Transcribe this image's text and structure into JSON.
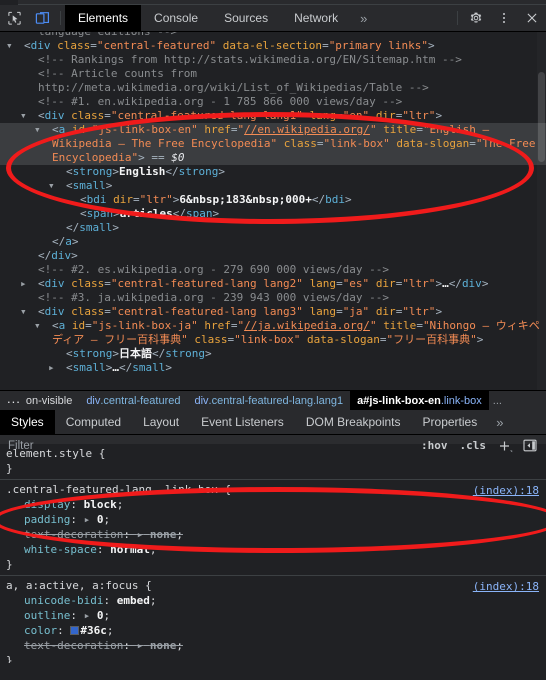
{
  "window": {
    "title": "Chrome DevTools — Elements panel"
  },
  "toolbar": {
    "icons": [
      {
        "name": "inspect-element-icon",
        "label": "Inspect element"
      },
      {
        "name": "device-toolbar-icon",
        "label": "Toggle device toolbar",
        "active": true
      }
    ],
    "tabs": [
      {
        "label": "Elements",
        "active": true
      },
      {
        "label": "Console",
        "active": false
      },
      {
        "label": "Sources",
        "active": false
      },
      {
        "label": "Network",
        "active": false
      }
    ],
    "more_tabs_label": "»",
    "right_icons": [
      {
        "name": "gear-icon",
        "label": "Settings"
      },
      {
        "name": "kebab-menu-icon",
        "label": "Customize and control DevTools"
      },
      {
        "name": "close-icon",
        "label": "Close DevTools"
      }
    ]
  },
  "dom": {
    "lines": [
      {
        "indent": 2,
        "type": "comment",
        "text": "language editions -->",
        "clipped_top": true
      },
      {
        "indent": 1,
        "type": "tag-open",
        "toggle": "open",
        "text": "<div class=\"central-featured\" data-el-section=\"primary links\">"
      },
      {
        "indent": 2,
        "type": "comment",
        "text": "<!-- Rankings from http://stats.wikimedia.org/EN/Sitemap.htm -->"
      },
      {
        "indent": 2,
        "type": "comment",
        "text": "<!-- Article counts from"
      },
      {
        "indent": 2,
        "type": "comment",
        "text": "http://meta.wikimedia.org/wiki/List_of_Wikipedias/Table -->"
      },
      {
        "indent": 2,
        "type": "comment",
        "text": "<!-- #1. en.wikipedia.org - 1 785 866 000 views/day -->"
      },
      {
        "indent": 2,
        "type": "tag-open",
        "toggle": "open",
        "text": "<div class=\"central-featured-lang lang1\" lang=\"en\" dir=\"ltr\">"
      },
      {
        "indent": 3,
        "type": "selected",
        "toggle": "open",
        "text": "<a id=\"js-link-box-en\" href=\"//en.wikipedia.org/\" title=\"English — Wikipedia — The Free Encyclopedia\" class=\"link-box\" data-slogan=\"The Free Encyclopedia\"> == $0"
      },
      {
        "indent": 4,
        "type": "element-text",
        "text": "<strong>English</strong>"
      },
      {
        "indent": 4,
        "type": "tag-open",
        "toggle": "open",
        "text": "<small>"
      },
      {
        "indent": 5,
        "type": "element-text",
        "text": "<bdi dir=\"ltr\">6&nbsp;183&nbsp;000+</bdi>"
      },
      {
        "indent": 5,
        "type": "element-text",
        "text": "<span>articles</span>"
      },
      {
        "indent": 4,
        "type": "tag-close",
        "text": "</small>"
      },
      {
        "indent": 3,
        "type": "tag-close",
        "text": "</a>"
      },
      {
        "indent": 2,
        "type": "tag-close",
        "text": "</div>"
      },
      {
        "indent": 2,
        "type": "comment",
        "text": "<!-- #2. es.wikipedia.org - 279 690 000 views/day -->"
      },
      {
        "indent": 2,
        "type": "tag-collapsed",
        "toggle": "closed",
        "text": "<div class=\"central-featured-lang lang2\" lang=\"es\" dir=\"ltr\">…</div>"
      },
      {
        "indent": 2,
        "type": "comment",
        "text": "<!-- #3. ja.wikipedia.org - 239 943 000 views/day -->"
      },
      {
        "indent": 2,
        "type": "tag-open",
        "toggle": "open",
        "text": "<div class=\"central-featured-lang lang3\" lang=\"ja\" dir=\"ltr\">"
      },
      {
        "indent": 3,
        "type": "tag-open",
        "toggle": "open",
        "text": "<a id=\"js-link-box-ja\" href=\"//ja.wikipedia.org/\" title=\"Nihongo — ウィキペディア — フリー百科事典\" class=\"link-box\" data-slogan=\"フリー百科事典\">"
      },
      {
        "indent": 4,
        "type": "element-text",
        "text": "<strong>日本語</strong>"
      },
      {
        "indent": 4,
        "type": "tag-collapsed",
        "toggle": "closed",
        "text": "<small>…</small>",
        "clipped_bottom": true
      }
    ]
  },
  "breadcrumb": {
    "ellipsis": "...",
    "items": [
      {
        "name": "on-visible",
        "cls": "",
        "active": false,
        "clipped": true
      },
      {
        "name": "div",
        "cls": ".central-featured",
        "active": false
      },
      {
        "name": "div",
        "cls": ".central-featured-lang.lang1",
        "active": false
      },
      {
        "name": "a#js-link-box-en",
        "cls": ".link-box",
        "active": true
      }
    ],
    "tail": "..."
  },
  "styles_pane": {
    "tabs": [
      {
        "label": "Styles",
        "active": true
      },
      {
        "label": "Computed",
        "active": false
      },
      {
        "label": "Layout",
        "active": false
      },
      {
        "label": "Event Listeners",
        "active": false
      },
      {
        "label": "DOM Breakpoints",
        "active": false
      },
      {
        "label": "Properties",
        "active": false
      }
    ],
    "more_tabs_label": "»",
    "filter": {
      "placeholder": "Filter",
      "value": ""
    },
    "buttons": [
      {
        "name": "hov-button",
        "label": ":hov"
      },
      {
        "name": "cls-button",
        "label": ".cls"
      },
      {
        "name": "new-style-rule-button",
        "label": "+"
      },
      {
        "name": "toggle-sidebar-button",
        "label": "sidebar-icon"
      }
    ],
    "rules": [
      {
        "selector": "element.style {",
        "source": "",
        "declarations": [],
        "close": "}",
        "clipped_top": true
      },
      {
        "selector": ".central-featured-lang .link-box {",
        "source": "(index):18",
        "declarations": [
          {
            "name": "display",
            "value": "block",
            "expandable": false,
            "disabled": false
          },
          {
            "name": "padding",
            "value": "0",
            "expandable": true,
            "disabled": false
          },
          {
            "name": "text-decoration",
            "value": "none",
            "expandable": true,
            "disabled": true
          },
          {
            "name": "white-space",
            "value": "normal",
            "expandable": false,
            "disabled": false
          }
        ],
        "close": "}"
      },
      {
        "selector": "a, a:active, a:focus {",
        "source": "(index):18",
        "declarations": [
          {
            "name": "unicode-bidi",
            "value": "embed",
            "expandable": false,
            "disabled": false
          },
          {
            "name": "outline",
            "value": "0",
            "expandable": true,
            "disabled": false
          },
          {
            "name": "color",
            "value": "#36c",
            "expandable": false,
            "disabled": false,
            "swatch": "#36c"
          },
          {
            "name": "text-decoration",
            "value": "none",
            "expandable": true,
            "disabled": true
          }
        ],
        "close": "}",
        "clipped_bottom": true
      }
    ]
  },
  "annotations": [
    {
      "name": "highlight-ellipse-dom",
      "shape": "ellipse",
      "color": "#f01b1b"
    },
    {
      "name": "highlight-ellipse-styles",
      "shape": "ellipse",
      "color": "#f01b1b"
    }
  ],
  "colors": {
    "accent": "#8ab4f8",
    "annotation": "#f01b1b",
    "link_color_value": "#36c"
  }
}
